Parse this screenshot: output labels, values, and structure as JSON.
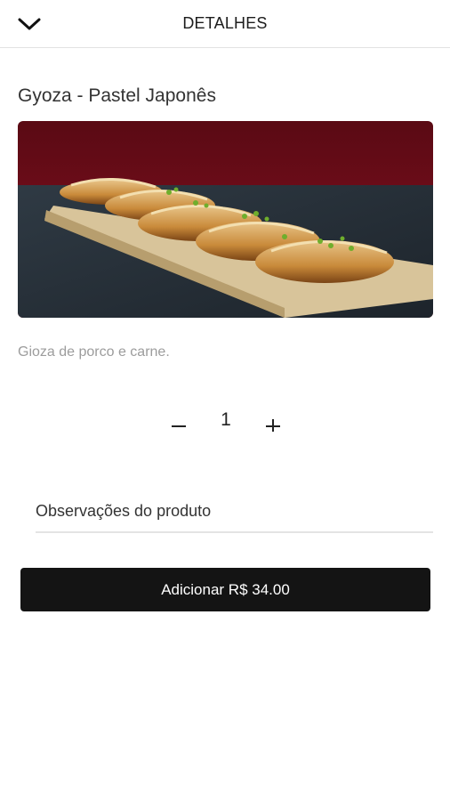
{
  "header": {
    "title": "DETALHES",
    "back_icon": "chevron-down-icon"
  },
  "product": {
    "name": "Gyoza - Pastel Japonês",
    "image": "gyoza-dumplings-photo",
    "description": "Gioza de porco e carne."
  },
  "quantity": {
    "value": "1",
    "minus_icon": "minus-icon",
    "plus_icon": "plus-icon"
  },
  "observations": {
    "placeholder": "Observações do produto",
    "value": ""
  },
  "add_button": {
    "label": "Adicionar R$ 34.00"
  },
  "colors": {
    "button_bg": "#141414",
    "button_text": "#ffffff",
    "description_text": "#9c9c9c"
  }
}
